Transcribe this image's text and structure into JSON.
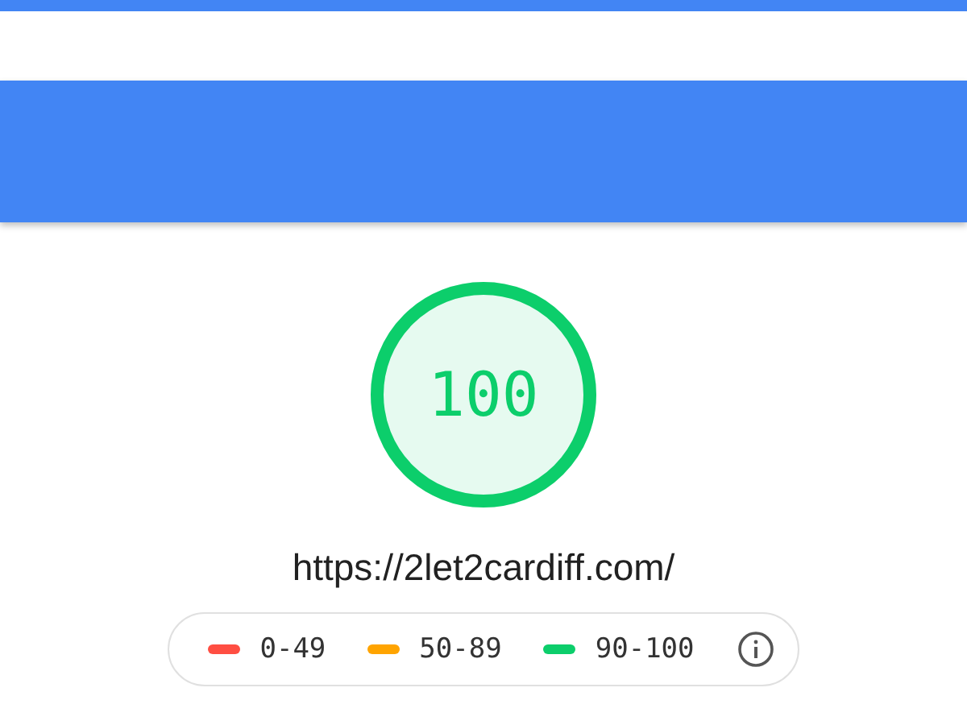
{
  "gauge": {
    "score": "100",
    "color": "#0cce6b"
  },
  "url": "https://2let2cardiff.com/",
  "legend": [
    {
      "range": "0-49",
      "color": "#ff4e42"
    },
    {
      "range": "50-89",
      "color": "#ffa400"
    },
    {
      "range": "90-100",
      "color": "#0cce6b"
    }
  ]
}
